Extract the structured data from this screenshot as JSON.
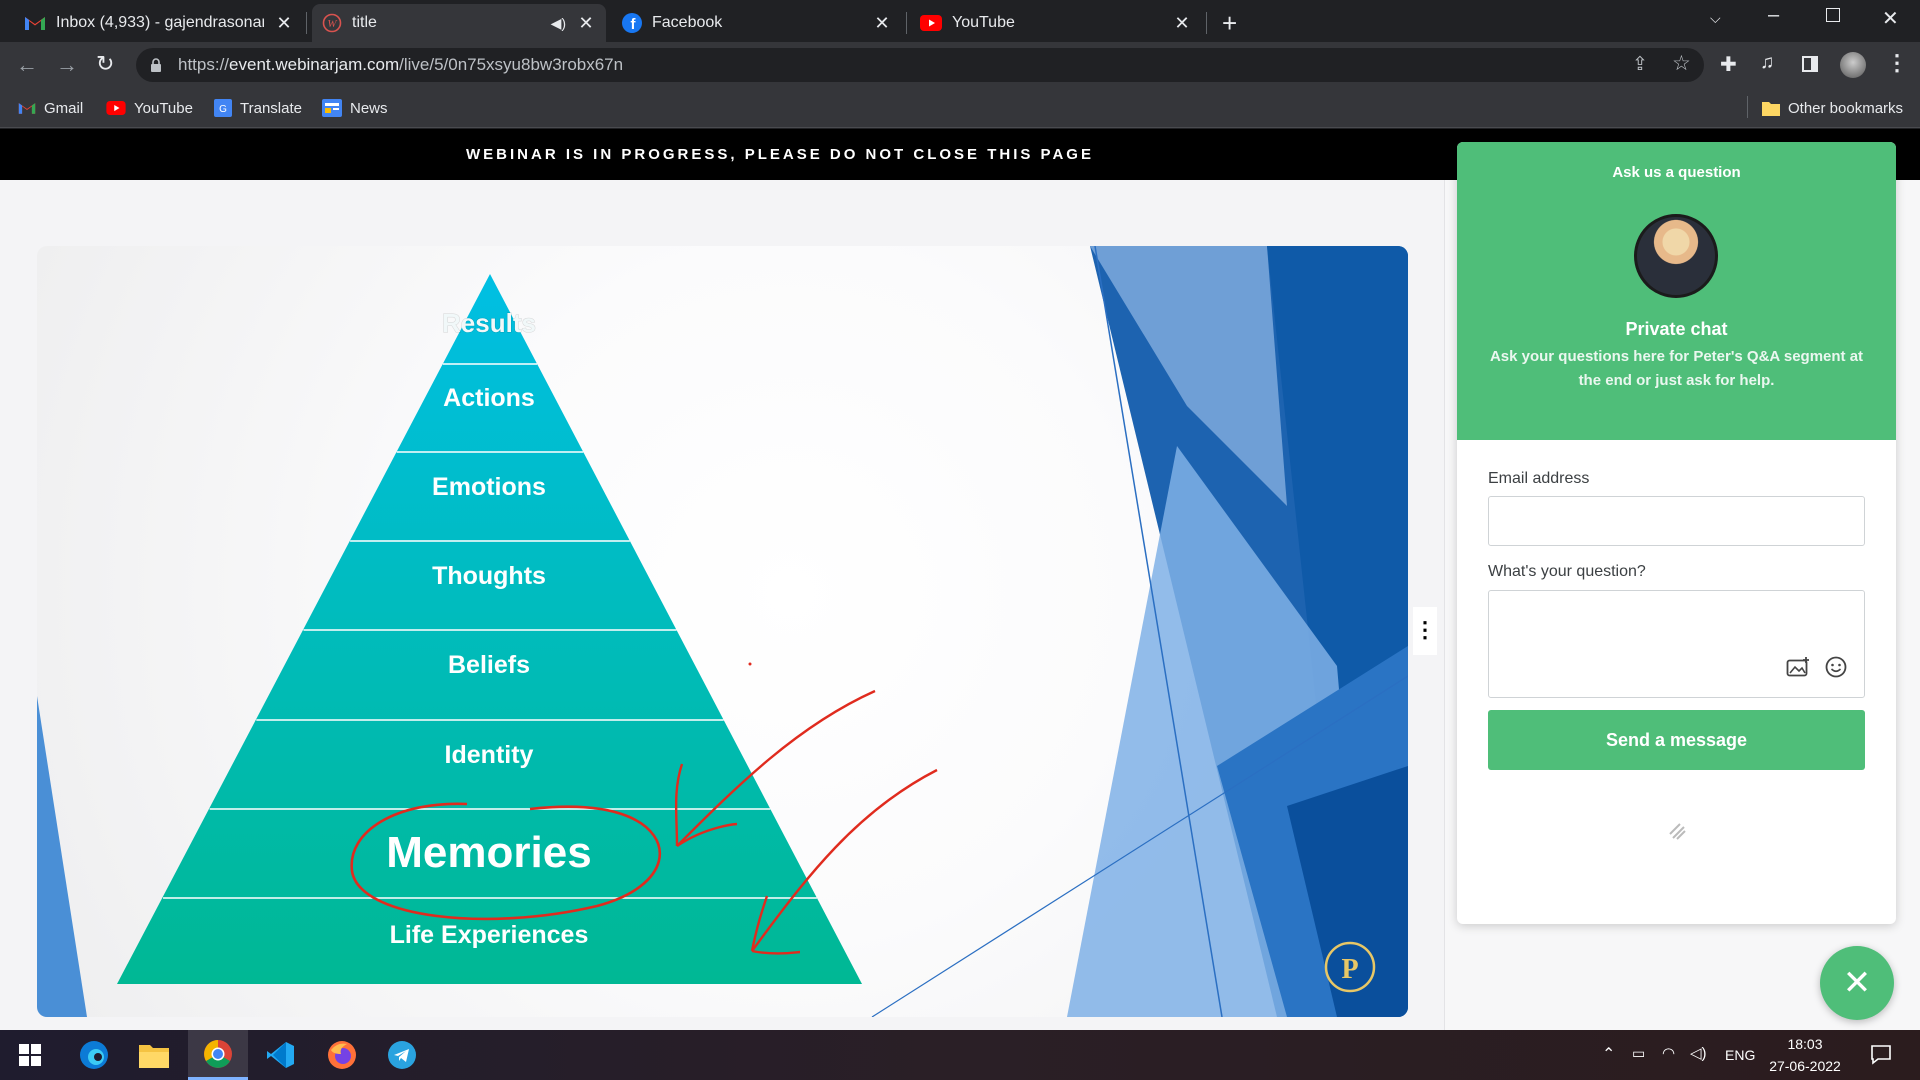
{
  "browser": {
    "tabs": [
      {
        "title": "Inbox (4,933) - gajendrasonare@",
        "icon": "gmail-icon"
      },
      {
        "title": "title",
        "icon": "webinarjam-icon",
        "audio": true
      },
      {
        "title": "Facebook",
        "icon": "facebook-icon"
      },
      {
        "title": "YouTube",
        "icon": "youtube-icon"
      }
    ],
    "url_prefix": "https://",
    "url_host": "event.webinarjam.com",
    "url_path": "/live/5/0n75xsyu8bw3robx67n",
    "bookmarks": [
      {
        "label": "Gmail",
        "icon": "gmail-icon"
      },
      {
        "label": "YouTube",
        "icon": "youtube-icon"
      },
      {
        "label": "Translate",
        "icon": "translate-icon"
      },
      {
        "label": "News",
        "icon": "news-icon"
      }
    ],
    "other_bookmarks": "Other bookmarks"
  },
  "banner": {
    "text": "WEBINAR IS IN PROGRESS, PLEASE DO NOT CLOSE THIS PAGE"
  },
  "slide": {
    "pyramid_levels": [
      "Results",
      "Actions",
      "Emotions",
      "Thoughts",
      "Beliefs",
      "Identity",
      "Memories",
      "Life Experiences"
    ],
    "logo_text": "P"
  },
  "chat": {
    "header": "Ask us a question",
    "title": "Private chat",
    "subtitle": "Ask your questions here for Peter's Q&A segment at the end or just ask for help.",
    "email_label": "Email address",
    "email_value": "",
    "question_label": "What's your question?",
    "question_value": "",
    "send_label": "Send a message",
    "fab_close": "✕"
  },
  "taskbar": {
    "apps": [
      "windows-start-icon",
      "edge-icon",
      "file-explorer-icon",
      "chrome-icon",
      "vscode-icon",
      "firefox-icon",
      "telegram-icon"
    ],
    "language": "ENG",
    "time": "18:03",
    "date": "27-06-2022"
  },
  "colors": {
    "accent_green": "#4fbe79",
    "pyramid_top": "#00bfe3",
    "pyramid_bottom": "#00b894",
    "slide_blue": "#1d63b0"
  }
}
